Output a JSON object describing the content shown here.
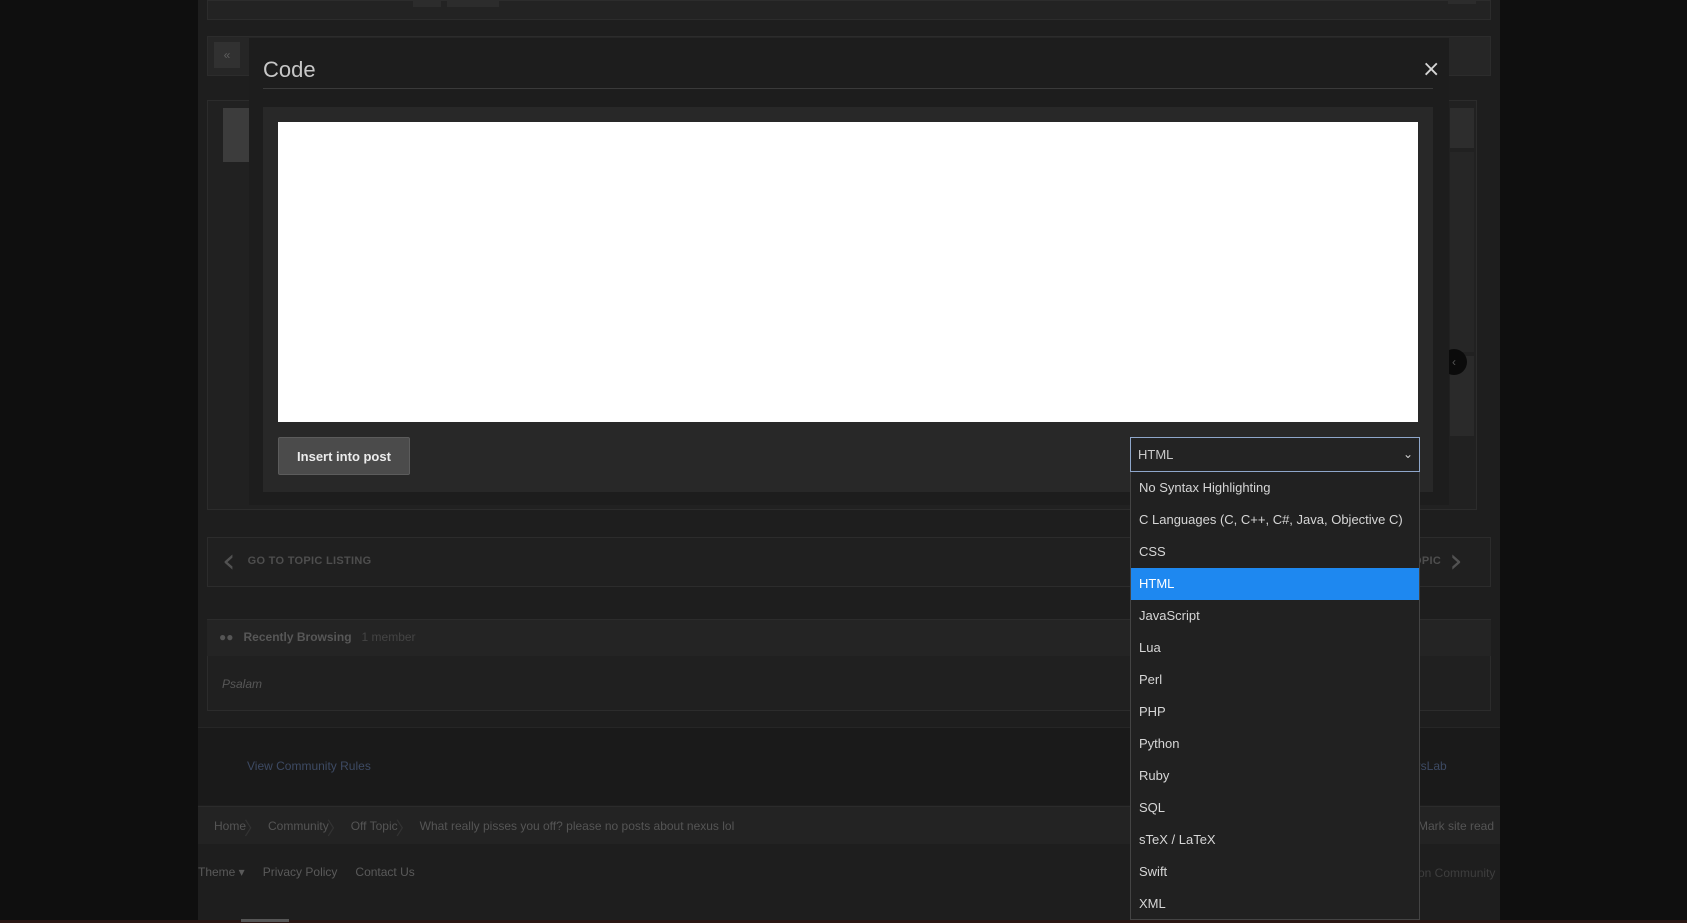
{
  "background": {
    "pagination_prev": "«",
    "nav": {
      "left": "GO TO TOPIC LISTING",
      "right_partial": "OPIC"
    },
    "recent": {
      "title": "Recently Browsing",
      "count": "1 member",
      "member": "Psalam"
    },
    "footer": {
      "rules_link": "View Community Rules",
      "brand_partial": "ersLab"
    },
    "breadcrumbs": [
      "Home",
      "Community",
      "Off Topic",
      "What really pisses you off? please no posts about nexus lol"
    ],
    "mark_read": "Mark site read",
    "bottom_links": {
      "theme": "Theme ▾",
      "privacy": "Privacy Policy",
      "contact": "Contact Us"
    },
    "bottom_right_partial": "on Community"
  },
  "modal": {
    "title": "Code",
    "close_symbol": "×",
    "code_value": "",
    "insert_button": "Insert into post",
    "select": {
      "selected": "HTML",
      "arrow": "⌄"
    },
    "options": [
      "No Syntax Highlighting",
      "C Languages (C, C++, C#, Java, Objective C)",
      "CSS",
      "HTML",
      "JavaScript",
      "Lua",
      "Perl",
      "PHP",
      "Python",
      "Ruby",
      "SQL",
      "sTeX / LaTeX",
      "Swift",
      "XML"
    ],
    "selected_index": 3
  },
  "colors": {
    "accent": "#1e88f0",
    "select_border": "#8fa7cb",
    "dim_link": "#3d4a63"
  }
}
